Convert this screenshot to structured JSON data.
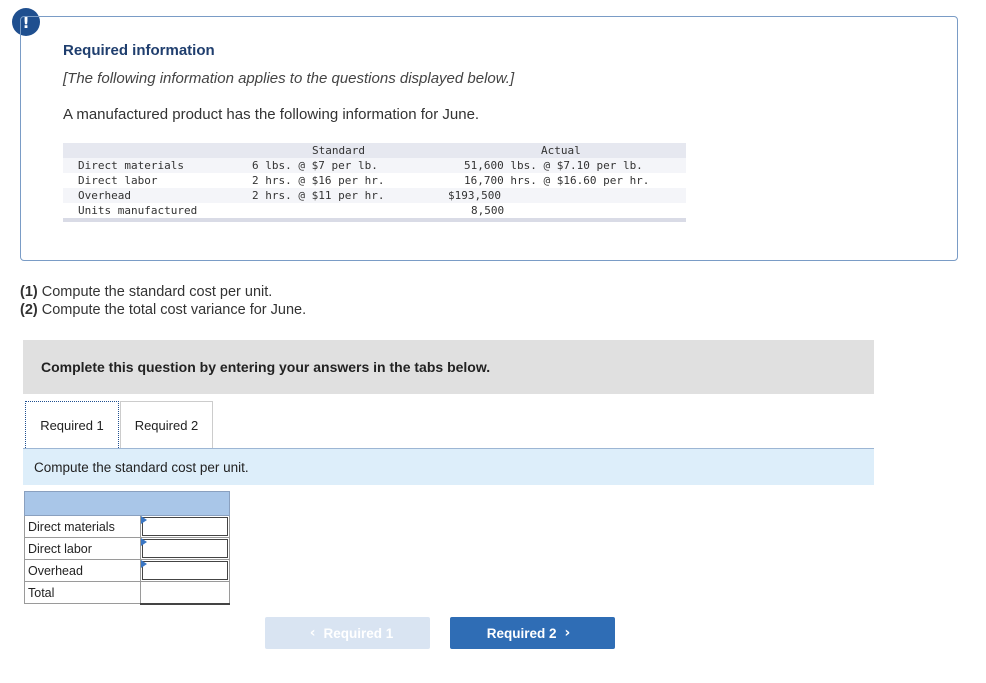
{
  "alert": {
    "glyph": "!"
  },
  "info": {
    "title": "Required information",
    "subtitle": "[The following information applies to the questions displayed below.]",
    "description": "A manufactured product has the following information for June."
  },
  "data_table": {
    "headers": {
      "standard": "Standard",
      "actual": "Actual"
    },
    "rows": [
      {
        "label": "Direct materials",
        "standard": "6 lbs. @ $7 per lb.",
        "actual": "51,600 lbs. @ $7.10 per lb."
      },
      {
        "label": "Direct labor",
        "standard": "2 hrs. @ $16 per hr.",
        "actual": "16,700 hrs. @ $16.60 per hr."
      },
      {
        "label": "Overhead",
        "standard": "2 hrs. @ $11 per hr.",
        "actual": "$193,500"
      },
      {
        "label": "Units manufactured",
        "standard": "",
        "actual": "8,500"
      }
    ]
  },
  "questions": [
    {
      "num": "(1)",
      "text": " Compute the standard cost per unit."
    },
    {
      "num": "(2)",
      "text": " Compute the total cost variance for June."
    }
  ],
  "banner": "Complete this question by entering your answers in the tabs below.",
  "tabs": [
    {
      "label": "Required 1"
    },
    {
      "label": "Required 2"
    }
  ],
  "instruction": "Compute the standard cost per unit.",
  "answer_rows": [
    {
      "label": "Direct materials",
      "value": ""
    },
    {
      "label": "Direct labor",
      "value": ""
    },
    {
      "label": "Overhead",
      "value": ""
    },
    {
      "label": "Total",
      "value": ""
    }
  ],
  "nav": {
    "prev_label": "Required 1",
    "next_label": "Required 2"
  },
  "colors": {
    "brand": "#1f4f8f",
    "next_button": "#2f6db5",
    "instruction_bg": "#ddeefa"
  }
}
